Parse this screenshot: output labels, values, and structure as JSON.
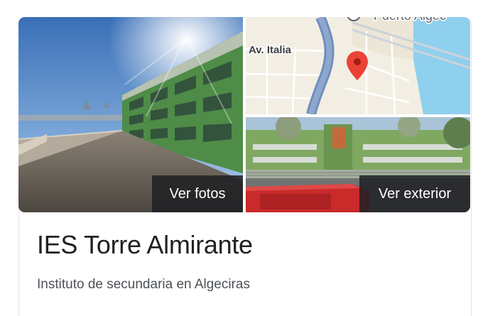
{
  "place": {
    "name": "IES Torre Almirante",
    "category": "Instituto de secundaria en Algeciras"
  },
  "photos": {
    "street_view_button": "Ver fotos",
    "exterior_button": "Ver exterior"
  },
  "map": {
    "street_label": "Av. Italia",
    "top_label": "Puerto Algec",
    "pin_color": "#ea4335"
  },
  "icons": {
    "pin": "map-pin-icon"
  }
}
